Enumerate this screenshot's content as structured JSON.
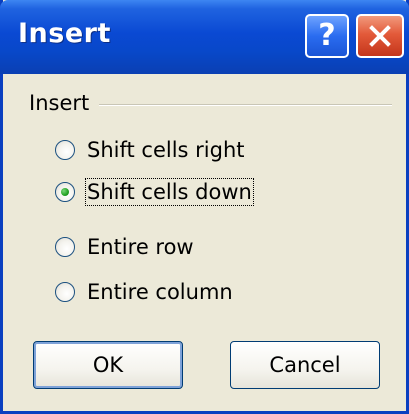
{
  "window": {
    "title": "Insert",
    "help_glyph": "?"
  },
  "group": {
    "label": "Insert"
  },
  "options": [
    {
      "label": "Shift cells right",
      "checked": false
    },
    {
      "label": "Shift cells down",
      "checked": true
    },
    {
      "label": "Entire row",
      "checked": false
    },
    {
      "label": "Entire column",
      "checked": false
    }
  ],
  "buttons": {
    "ok_label": "OK",
    "cancel_label": "Cancel"
  },
  "icons": {
    "help": "help-icon",
    "close": "close-icon",
    "radio_selected": "radio-selected-icon",
    "radio_unselected": "radio-unselected-icon"
  },
  "colors": {
    "titlebar": "#0a49d3",
    "dialog_background": "#ece9d8",
    "close_button": "#e35a3a",
    "radio_dot": "#21a121"
  }
}
